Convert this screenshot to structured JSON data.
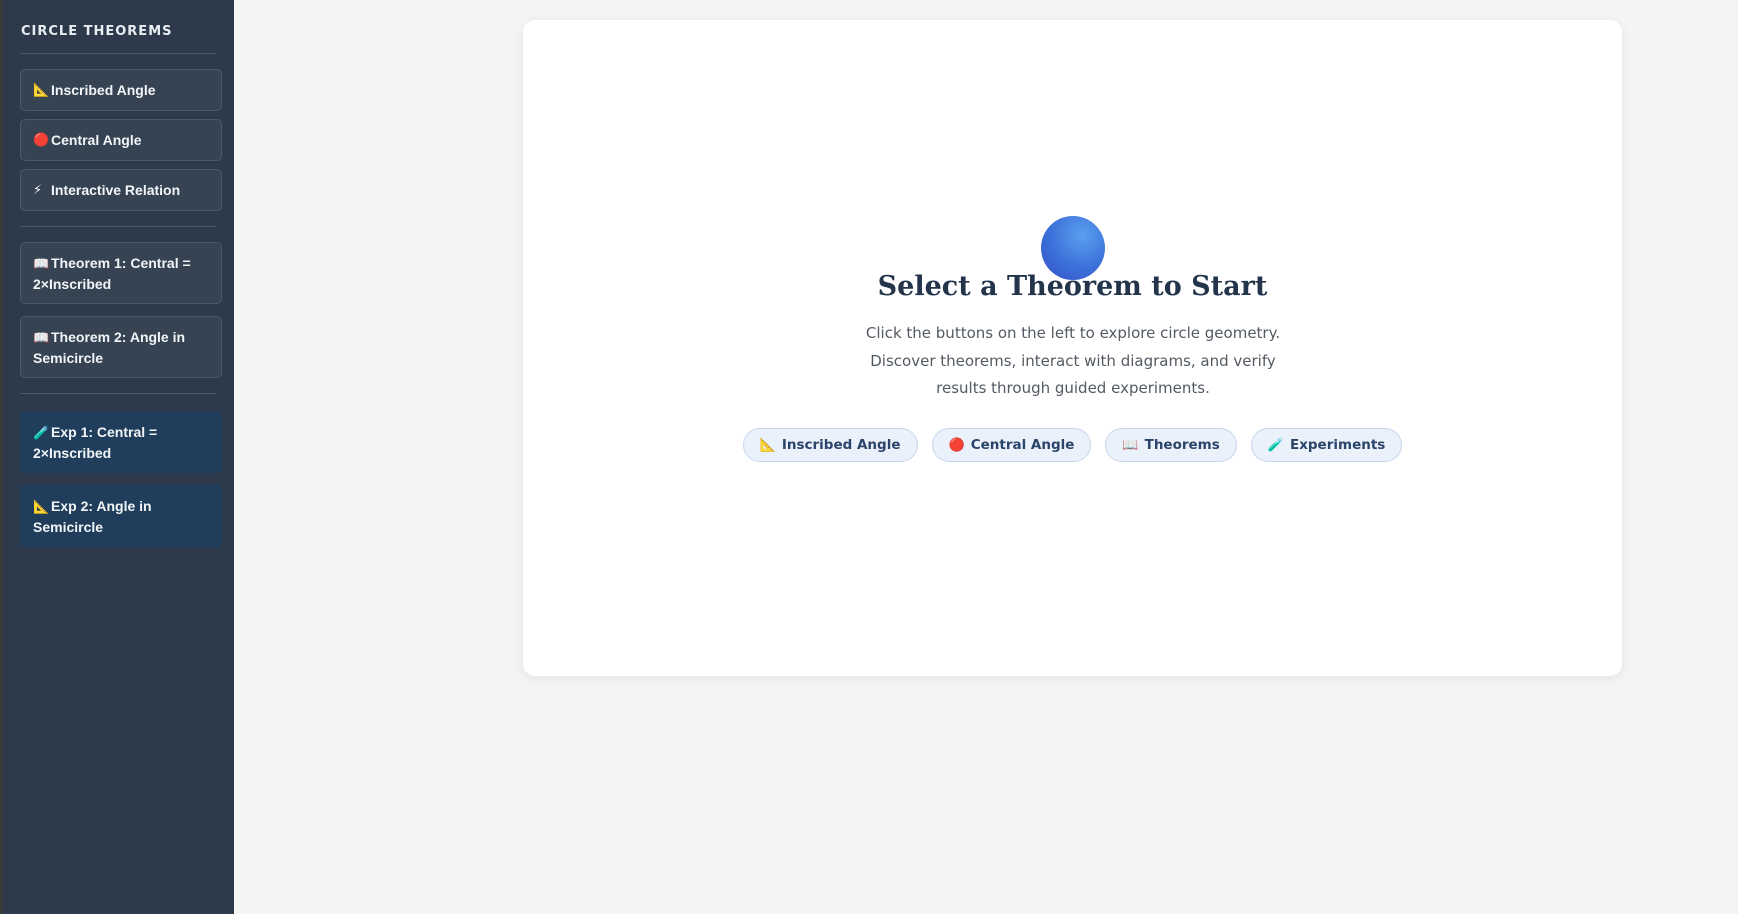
{
  "sidebar": {
    "title": "CIRCLE THEOREMS",
    "explore": [
      {
        "icon": "triangle-ruler-icon",
        "glyph": "📐",
        "label": "Inscribed Angle"
      },
      {
        "icon": "red-circle-icon",
        "glyph": "🔴",
        "label": "Central Angle"
      },
      {
        "icon": "lightning-icon",
        "glyph": "⚡",
        "label": "Interactive Relation"
      }
    ],
    "theorems": [
      {
        "icon": "book-icon",
        "glyph": "📖",
        "label": "Theorem 1: Central = 2×Inscribed"
      },
      {
        "icon": "book-icon",
        "glyph": "📖",
        "label": "Theorem 2: Angle in Semicircle"
      }
    ],
    "experiments": [
      {
        "icon": "test-tube-icon",
        "glyph": "🧪",
        "label": "Exp 1: Central = 2×Inscribed"
      },
      {
        "icon": "triangle-ruler-icon",
        "glyph": "📐",
        "label": "Exp 2: Angle in Semicircle"
      }
    ]
  },
  "main": {
    "title": "Select a Theorem to Start",
    "description": "Click the buttons on the left to explore circle geometry. Discover theorems, interact with diagrams, and verify results through guided experiments.",
    "chips": [
      {
        "icon": "triangle-ruler-icon",
        "glyph": "📐",
        "label": "Inscribed Angle"
      },
      {
        "icon": "red-circle-icon",
        "glyph": "🔴",
        "label": "Central Angle"
      },
      {
        "icon": "book-icon",
        "glyph": "📖",
        "label": "Theorems"
      },
      {
        "icon": "test-tube-icon",
        "glyph": "🧪",
        "label": "Experiments"
      }
    ]
  },
  "colors": {
    "sidebar_bg": "#2d3a4b",
    "experiment_button_bg": "#203e5c",
    "orb_blue": "#3b6fd8",
    "title_text": "#23344b"
  }
}
